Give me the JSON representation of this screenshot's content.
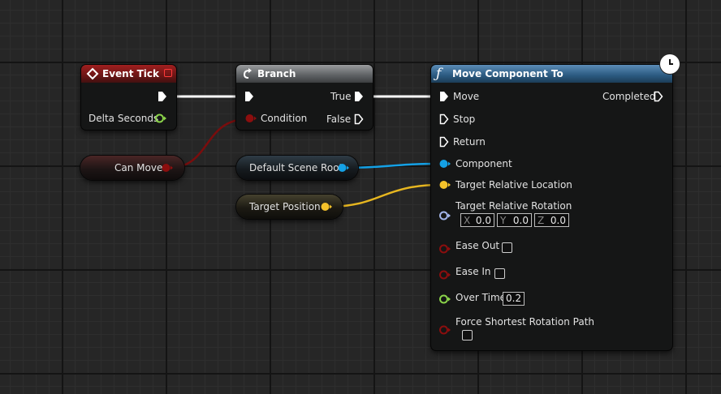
{
  "nodes": {
    "event_tick": {
      "title": "Event Tick",
      "pins": {
        "delta_seconds": "Delta Seconds"
      }
    },
    "branch": {
      "title": "Branch",
      "pins": {
        "condition": "Condition",
        "true_label": "True",
        "false_label": "False"
      }
    },
    "move_component": {
      "title": "Move Component To",
      "pins": {
        "move": "Move",
        "stop": "Stop",
        "return_label": "Return",
        "completed": "Completed",
        "component": "Component",
        "target_location": "Target Relative Location",
        "target_rotation": "Target Relative Rotation",
        "ease_out": "Ease Out",
        "ease_in": "Ease In",
        "over_time": "Over Time",
        "force_shortest": "Force Shortest Rotation Path"
      },
      "rotation": {
        "x_label": "X",
        "x": "0.0",
        "y_label": "Y",
        "y": "0.0",
        "z_label": "Z",
        "z": "0.0"
      },
      "over_time_value": "0.2",
      "ease_out_checked": false,
      "ease_in_checked": false,
      "force_shortest_checked": false
    }
  },
  "variables": {
    "can_move": "Can Move",
    "scene_root": "Default Scene Root",
    "target_position": "Target Position"
  },
  "colors": {
    "exec": "#ffffff",
    "bool": "#8c0e0e",
    "float": "#8bd44a",
    "object": "#14a1e6",
    "vector": "#f5c22a",
    "rotator": "#a4b5ea"
  },
  "icons": {
    "event": "event-diamond-icon",
    "branch": "branch-arrow-icon",
    "function": "function-f-icon",
    "latent": "clock-icon",
    "delegate": "delegate-square-icon"
  }
}
